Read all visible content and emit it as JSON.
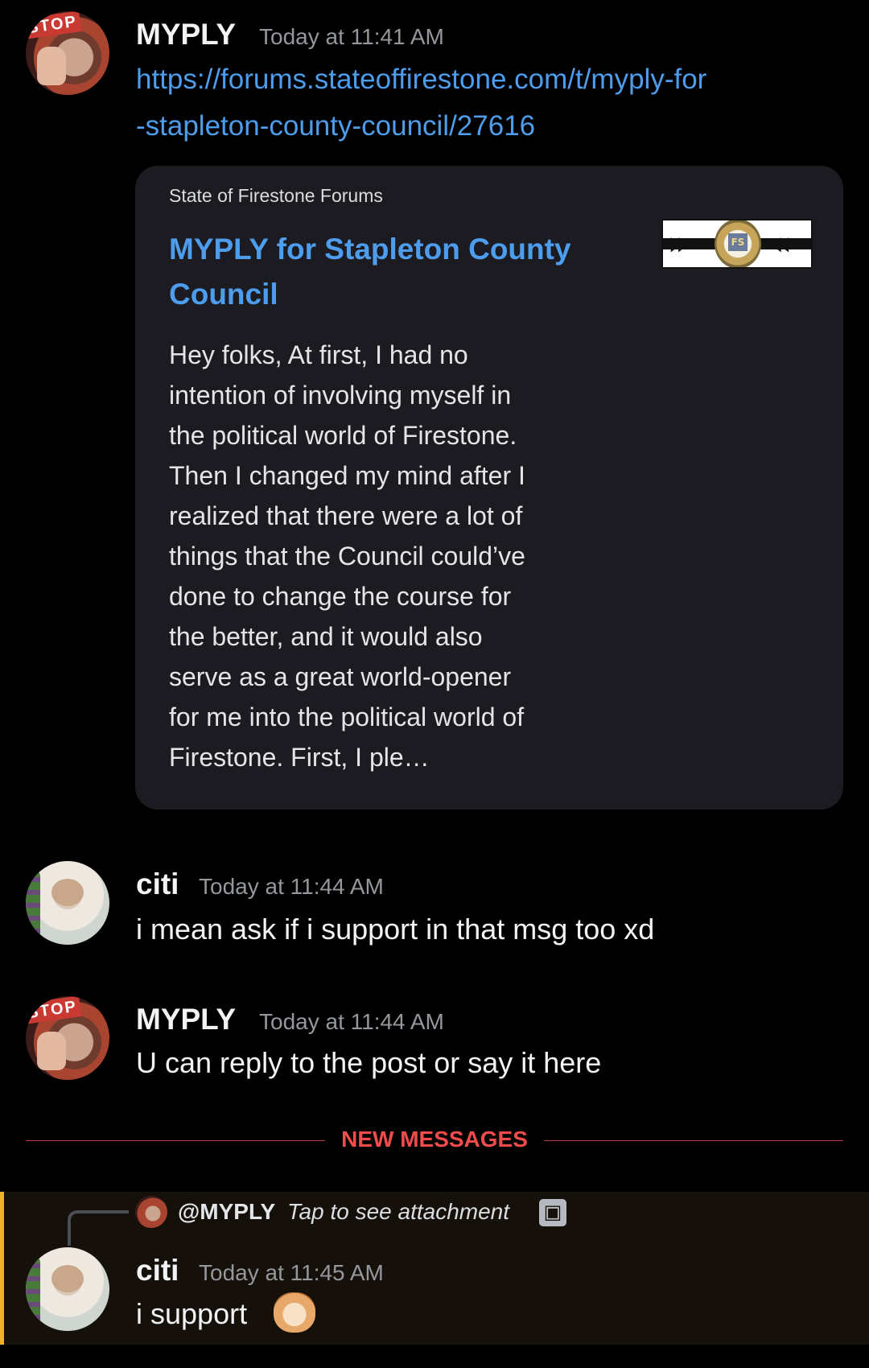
{
  "messages": [
    {
      "author": "MYPLY",
      "time": "Today at 11:41 AM",
      "link_line1": "https://forums.stateoffirestone.com/t/myply-for",
      "link_line2": "-stapleton-county-council/27616",
      "embed": {
        "provider": "State of Firestone Forums",
        "title": "MYPLY for Stapleton County Council",
        "description": "Hey folks,  At first, I had no\nintention of involving myself in\nthe political world of Firestone.\nThen I changed my mind after I\nrealized that there were a lot of\nthings that the Council could’ve\ndone to change the course for\nthe better, and it would also\nserve as a great world-opener\nfor me into the political world of\nFirestone.    First, I ple…",
        "thumbnail_badge": "FS"
      }
    },
    {
      "author": "citi",
      "time": "Today at 11:44 AM",
      "text": "i mean ask if i support in that msg too xd"
    },
    {
      "author": "MYPLY",
      "time": "Today at 11:44 AM",
      "text": "U can reply to the post or say it here"
    },
    {
      "author": "citi",
      "time": "Today at 11:45 AM",
      "text": "i support",
      "reply": {
        "mention": "@MYPLY",
        "preview": "Tap to see attachment",
        "icon": "image-icon"
      },
      "emoji": "cat-emoji"
    }
  ],
  "divider": {
    "label": "NEW MESSAGES"
  },
  "avatars": {
    "myply_badge": "STOP"
  },
  "colors": {
    "background": "#000000",
    "link": "#4e9cec",
    "new_messages": "#f24b4b",
    "highlight_bar": "#f0b132",
    "embed_bg": "#1b1b21"
  }
}
